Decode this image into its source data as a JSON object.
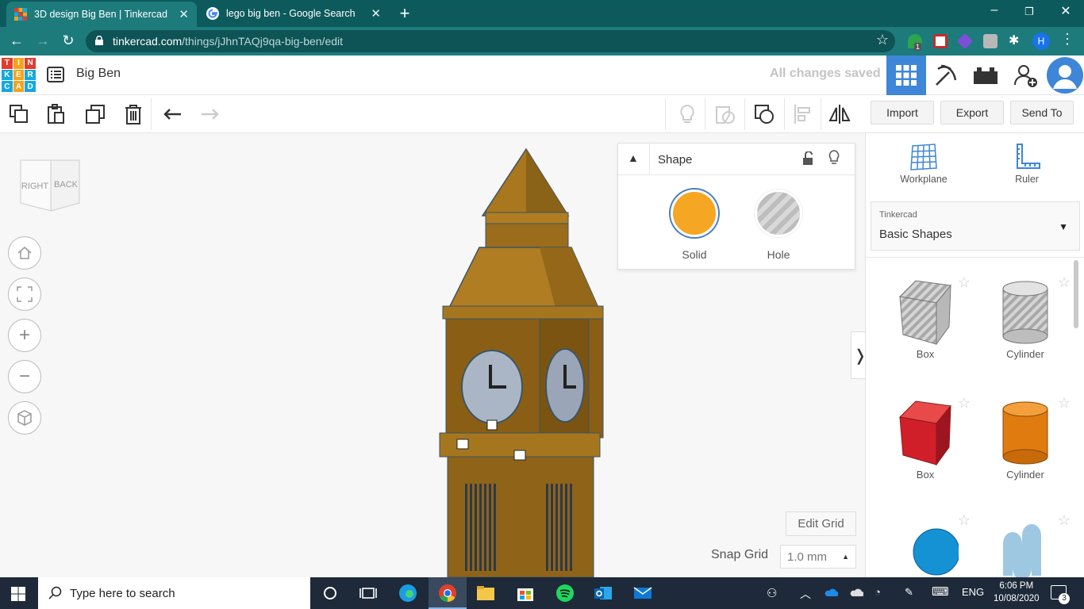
{
  "browser": {
    "tabs": [
      {
        "title": "3D design Big Ben | Tinkercad",
        "active": true
      },
      {
        "title": "lego big ben - Google Search",
        "active": false
      }
    ],
    "url_host": "tinkercad.com",
    "url_path": "/things/jJhnTAQj9qa-big-ben/edit",
    "extension_badge": "1",
    "profile_initial": "H"
  },
  "app": {
    "logo_letters": [
      "T",
      "I",
      "N",
      "K",
      "E",
      "R",
      "C",
      "A",
      "D"
    ],
    "design_title": "Big Ben",
    "save_status": "All changes saved"
  },
  "toolbar": {
    "import_label": "Import",
    "export_label": "Export",
    "sendto_label": "Send To"
  },
  "viewcube": {
    "left_face": "RIGHT",
    "right_face": "BACK"
  },
  "shape_panel": {
    "title": "Shape",
    "solid_label": "Solid",
    "hole_label": "Hole",
    "solid_color": "#f5a623"
  },
  "grid": {
    "edit_label": "Edit Grid",
    "snap_label": "Snap Grid",
    "snap_value": "1.0 mm"
  },
  "right_panel": {
    "workplane_label": "Workplane",
    "ruler_label": "Ruler",
    "library_source": "Tinkercad",
    "library_name": "Basic Shapes",
    "shapes": [
      {
        "label": "Box",
        "style": "hole"
      },
      {
        "label": "Cylinder",
        "style": "hole"
      },
      {
        "label": "Box",
        "style": "red"
      },
      {
        "label": "Cylinder",
        "style": "orange"
      }
    ]
  },
  "taskbar": {
    "search_placeholder": "Type here to search",
    "language": "ENG",
    "time": "6:06 PM",
    "date": "10/08/2020",
    "notification_count": "3"
  }
}
